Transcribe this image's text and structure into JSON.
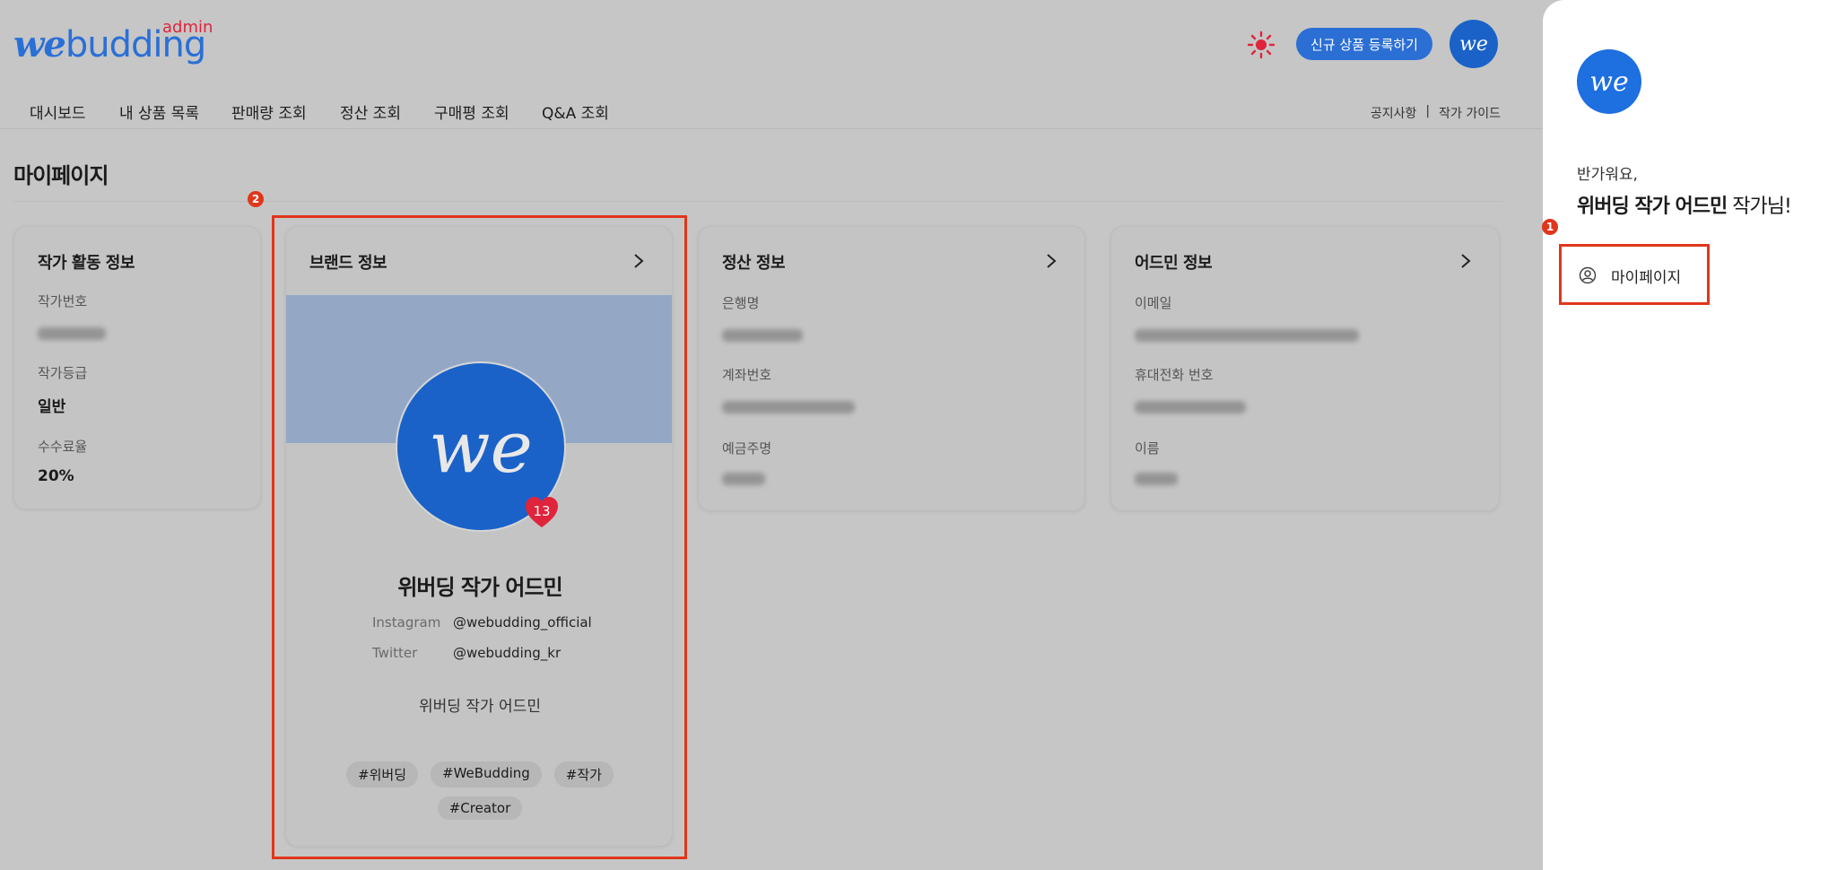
{
  "header": {
    "logo_main_we": "we",
    "logo_main_rest": "budding",
    "logo_sub": "admin",
    "register_button": "신규 상품 등록하기",
    "avatar_text": "we",
    "theme_icon": "sun-icon"
  },
  "nav": {
    "items": [
      "대시보드",
      "내 상품 목록",
      "판매량 조회",
      "정산 조회",
      "구매평 조회",
      "Q&A 조회"
    ],
    "notice": "공지사항",
    "separator": "|",
    "guide": "작가 가이드"
  },
  "page": {
    "title": "마이페이지"
  },
  "activity_card": {
    "title": "작가 활동 정보",
    "number_label": "작가번호",
    "grade_label": "작가등급",
    "grade_value": "일반",
    "fee_label": "수수료율",
    "fee_value": "20%"
  },
  "brand_card": {
    "title": "브랜드 정보",
    "avatar_text": "we",
    "likes": "13",
    "name": "위버딩 작가 어드민",
    "instagram_label": "Instagram",
    "instagram_value": "@webudding_official",
    "twitter_label": "Twitter",
    "twitter_value": "@webudding_kr",
    "description": "위버딩 작가 어드민",
    "tags": [
      "#위버딩",
      "#WeBudding",
      "#작가",
      "#Creator"
    ]
  },
  "settlement_card": {
    "title": "정산 정보",
    "bank_label": "은행명",
    "account_label": "계좌번호",
    "holder_label": "예금주명"
  },
  "admin_card": {
    "title": "어드민 정보",
    "email_label": "이메일",
    "phone_label": "휴대전화 번호",
    "name_label": "이름"
  },
  "annotations": {
    "step1": "1",
    "step2": "2",
    "color": "#e0361c"
  },
  "panel": {
    "avatar_text": "we",
    "greeting": "반가워요,",
    "user_name": "위버딩 작가 어드민",
    "user_suffix": " 작가님!",
    "mypage_label": "마이페이지"
  },
  "colors": {
    "brand_blue": "#1a62c8",
    "accent_red": "#e0243b",
    "overlay": "#c6c6c6"
  }
}
